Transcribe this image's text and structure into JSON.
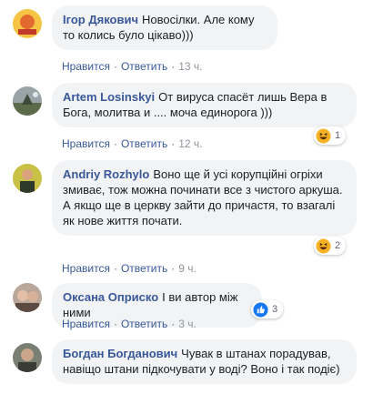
{
  "comments": [
    {
      "author": "Ігор Дякович",
      "text": "Новосілки. Але кому то колись було цікаво)))",
      "like": "Нравится",
      "reply": "Ответить",
      "time": "13 ч."
    },
    {
      "author": "Artem Losinskyi",
      "text": "От вируса спасёт лишь Вера в Бога, молитва и .... моча единорога )))",
      "like": "Нравится",
      "reply": "Ответить",
      "time": "12 ч.",
      "reaction": {
        "icon": "haha-icon",
        "count": "1"
      }
    },
    {
      "author": "Andriy Rozhylo",
      "text": "Воно ще й усі корупційні огріхи змиває, тож можна починати все з чистого аркуша. А якщо ще в церкву зайти до причастя, то взагалі як нове життя почати.",
      "like": "Нравится",
      "reply": "Ответить",
      "time": "9 ч.",
      "reaction": {
        "icon": "haha-icon",
        "count": "2"
      }
    },
    {
      "author": "Оксана Оприско",
      "text": "І ви автор між ними",
      "like": "Нравится",
      "reply": "Ответить",
      "time": "3 ч.",
      "reaction": {
        "icon": "like-icon",
        "count": "3"
      }
    },
    {
      "author": "Богдан Богданович",
      "text": "Чувак в штанах порадував, навіщо штани підкочувати у воді? Воно і так подіє)"
    }
  ],
  "colors": {
    "author": "#385898",
    "bubble": "#f2f3f5",
    "meta": "#606770",
    "time": "#90949c"
  }
}
